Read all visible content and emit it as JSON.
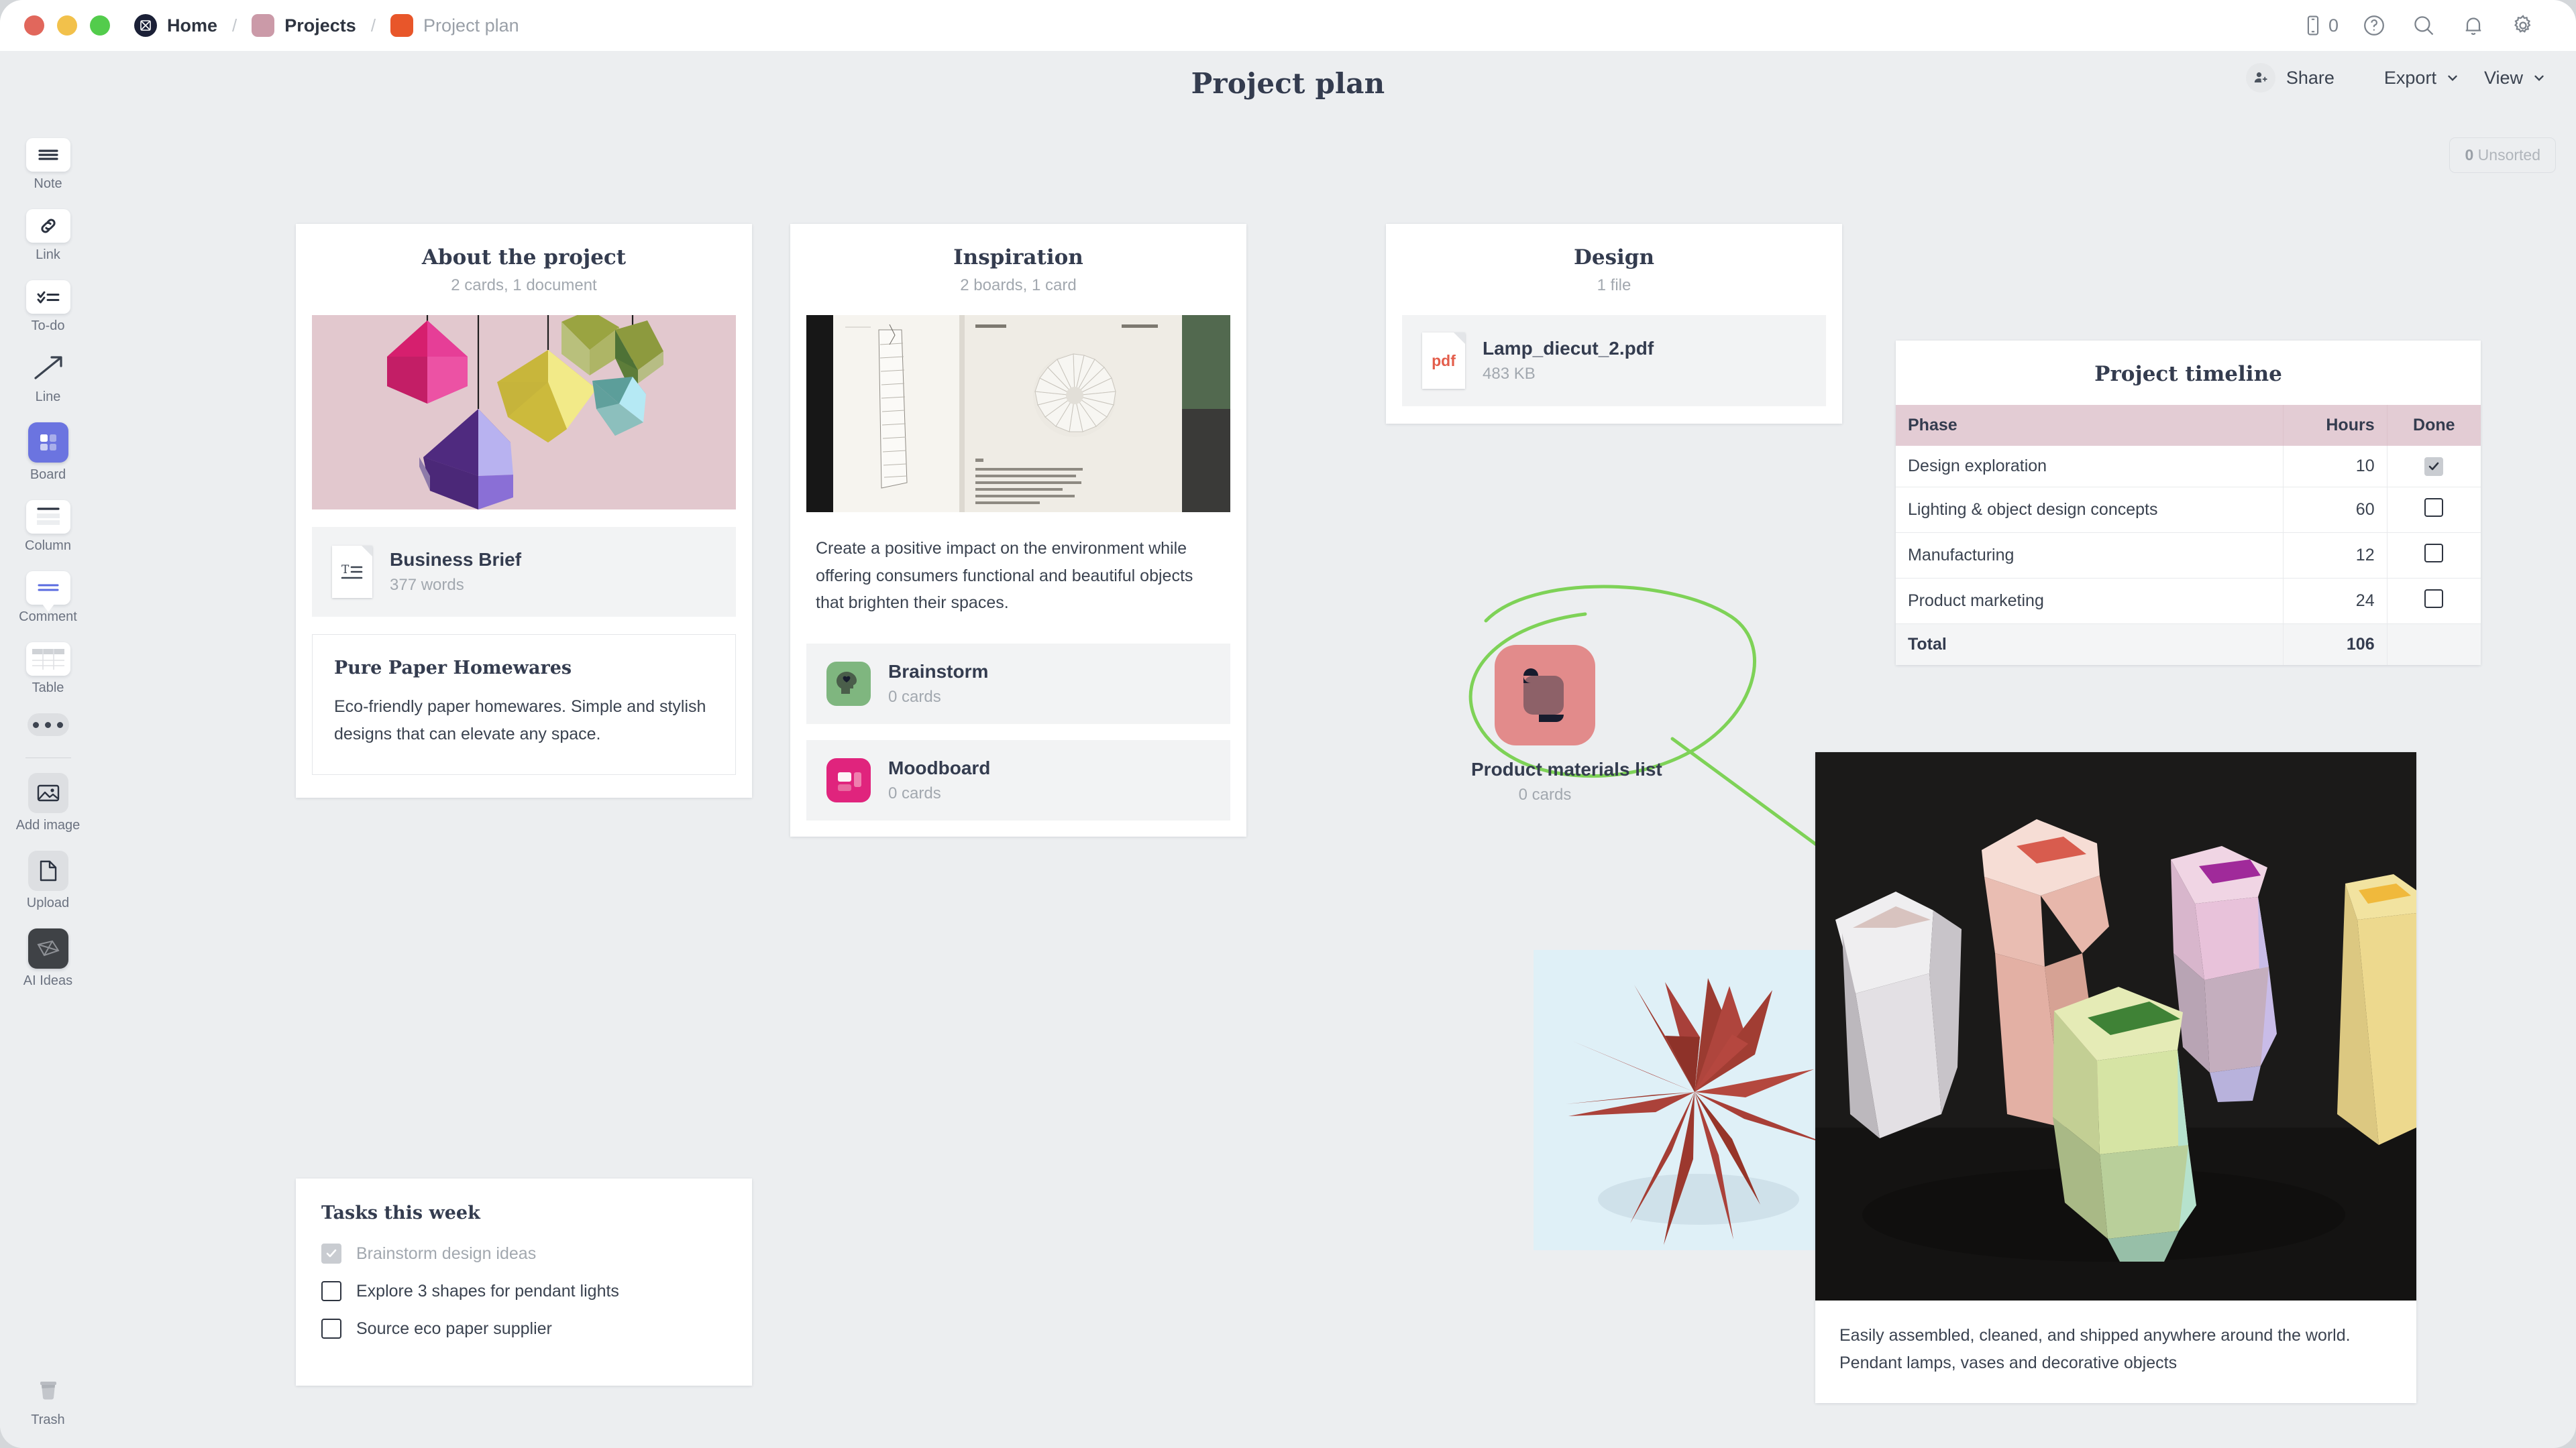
{
  "window": {
    "traffic_lights": [
      "close",
      "minimize",
      "maximize"
    ]
  },
  "breadcrumb": {
    "items": [
      {
        "label": "Home",
        "icon": "milanote-logo-icon",
        "muted": false
      },
      {
        "label": "Projects",
        "icon": "folder-badge-icon",
        "muted": false
      },
      {
        "label": "Project plan",
        "icon": "folder-badge-icon",
        "muted": true
      }
    ],
    "separator": "/"
  },
  "titlebar_right": {
    "mobile_count": "0",
    "icons": [
      "mobile-icon",
      "help-icon",
      "search-icon",
      "notifications-icon",
      "settings-icon"
    ]
  },
  "header": {
    "title": "Project plan",
    "share_label": "Share",
    "export_label": "Export",
    "view_label": "View"
  },
  "canvas": {
    "unsorted_count": "0",
    "unsorted_label": "Unsorted"
  },
  "sidebar": {
    "tools": [
      {
        "label": "Note",
        "icon": "note-icon"
      },
      {
        "label": "Link",
        "icon": "link-icon"
      },
      {
        "label": "To-do",
        "icon": "todo-icon"
      },
      {
        "label": "Line",
        "icon": "line-arrow-icon"
      },
      {
        "label": "Board",
        "icon": "board-icon"
      },
      {
        "label": "Column",
        "icon": "column-icon"
      },
      {
        "label": "Comment",
        "icon": "comment-icon"
      },
      {
        "label": "Table",
        "icon": "table-icon"
      },
      {
        "label": "More",
        "icon": "more-dots-icon"
      },
      {
        "label": "Add image",
        "icon": "image-icon"
      },
      {
        "label": "Upload",
        "icon": "upload-file-icon"
      },
      {
        "label": "AI Ideas",
        "icon": "ai-ideas-icon"
      }
    ],
    "trash": {
      "label": "Trash",
      "icon": "trash-icon"
    }
  },
  "about_card": {
    "title": "About the project",
    "subtitle": "2 cards, 1 document",
    "hero_alt": "geometric pendant lamps illustration",
    "document": {
      "name": "Business Brief",
      "meta": "377 words",
      "icon": "text-document-icon"
    },
    "note": {
      "heading": "Pure Paper Homewares",
      "body": "Eco-friendly paper homewares. Simple and stylish designs that can elevate any space."
    }
  },
  "tasks_card": {
    "heading": "Tasks this week",
    "items": [
      {
        "label": "Brainstorm design ideas",
        "done": true
      },
      {
        "label": "Explore 3 shapes for pendant lights",
        "done": false
      },
      {
        "label": "Source eco paper supplier",
        "done": false
      }
    ]
  },
  "inspiration_card": {
    "title": "Inspiration",
    "subtitle": "2 boards, 1 card",
    "image_alt": "open book with paper folding diagram",
    "quote": "Create a positive impact on the environment while offering consumers functional and beautiful objects that brighten their spaces.",
    "boards": [
      {
        "name": "Brainstorm",
        "meta": "0 cards",
        "icon": "head-heart-icon",
        "color": "#7fb67f"
      },
      {
        "name": "Moodboard",
        "meta": "0 cards",
        "icon": "moodboard-icon",
        "color": "#e0247d"
      }
    ]
  },
  "design_card": {
    "title": "Design",
    "subtitle": "1 file",
    "file": {
      "name": "Lamp_diecut_2.pdf",
      "size": "483 KB",
      "icon": "pdf-file-icon",
      "badge": "pdf"
    }
  },
  "floating_board": {
    "name": "Product materials list",
    "meta": "0 cards",
    "icon": "scroll-icon",
    "color": "#e28b8b",
    "annotation_color": "#7ed257"
  },
  "star_image": {
    "alt": "red folded paper star sculpture"
  },
  "photo_card": {
    "alt": "pastel paper vases on dark surface",
    "caption": "Easily assembled, cleaned, and shipped anywhere around the world. Pendant lamps, vases and decorative objects"
  },
  "timeline_card": {
    "title": "Project timeline",
    "columns": [
      "Phase",
      "Hours",
      "Done"
    ],
    "rows": [
      {
        "phase": "Design exploration",
        "hours": "10",
        "done": true
      },
      {
        "phase": "Lighting & object design concepts",
        "hours": "60",
        "done": false
      },
      {
        "phase": "Manufacturing",
        "hours": "12",
        "done": false
      },
      {
        "phase": "Product marketing",
        "hours": "24",
        "done": false
      }
    ],
    "total_label": "Total",
    "total_hours": "106"
  },
  "chart_data": {
    "type": "table",
    "title": "Project timeline",
    "categories": [
      "Design exploration",
      "Lighting & object design concepts",
      "Manufacturing",
      "Product marketing"
    ],
    "values": [
      10,
      60,
      12,
      24
    ],
    "series": [
      {
        "name": "Hours",
        "values": [
          10,
          60,
          12,
          24
        ]
      }
    ],
    "done_flags": [
      true,
      false,
      false,
      false
    ],
    "total": 106,
    "xlabel": "Phase",
    "ylabel": "Hours"
  }
}
